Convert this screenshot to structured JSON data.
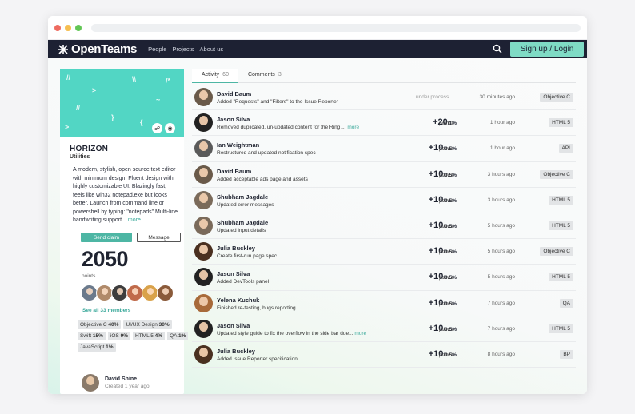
{
  "app": {
    "brand": "OpenTeams",
    "nav_links": [
      "People",
      "Projects",
      "About us"
    ],
    "signup_label": "Sign up / Login",
    "icons": {
      "search": "search-icon",
      "logo": "openteams-logo-icon"
    }
  },
  "project": {
    "title": "HORIZON",
    "category": "Utilities",
    "description": "A modern, stylish, open source text editor with minimum design. Fluent design with highly customizable UI. Blazingly fast, feels like win32 notepad.exe but looks better. Launch from command line or powershell by typing: \"notepads\" Multi-line handwriting support...",
    "more_label": "more",
    "send_claim_label": "Send claim",
    "message_label": "Message",
    "points": "2050",
    "points_label": "points",
    "see_all_label": "See all 33 members",
    "member_colors": [
      "#6b7a8c",
      "#b08a6a",
      "#3e3e3e",
      "#c06a4a",
      "#d9a24a",
      "#8a5a3a"
    ],
    "tags": [
      {
        "name": "Objective C",
        "pct": "40%"
      },
      {
        "name": "UI/UX Design",
        "pct": "30%"
      },
      {
        "name": "Swift",
        "pct": "15%"
      },
      {
        "name": "iOS",
        "pct": "9%"
      },
      {
        "name": "HTML 5",
        "pct": "4%"
      },
      {
        "name": "QA",
        "pct": "1%"
      },
      {
        "name": "JavaScript",
        "pct": "1%"
      }
    ],
    "creator": {
      "name": "David Shine",
      "created": "Created 1 year ago"
    },
    "banner_marks": [
      "//",
      ">",
      "\\\\",
      "~",
      "//",
      "}",
      "{",
      "/*",
      ">"
    ]
  },
  "tabs": [
    {
      "label": "Activity",
      "count": "60",
      "active": true
    },
    {
      "label": "Comments",
      "count": "3",
      "active": false
    }
  ],
  "activity": [
    {
      "name": "David Baum",
      "desc": "Added \"Requests\" and \"Filters\" to the Issue Reporter",
      "more": "",
      "status": "under process",
      "points": "",
      "unit": "",
      "points_label": "",
      "time": "30 minutes ago",
      "tag": "Objective C",
      "avatar": "#6a5a4a"
    },
    {
      "name": "Jason Silva",
      "desc": "Removed duplicated, un-updated content for the Ring ...",
      "more": "more",
      "status": "",
      "points": "+20",
      "unit": "/1%",
      "points_label": "points",
      "time": "1 hour ago",
      "tag": "HTML 5",
      "avatar": "#222222"
    },
    {
      "name": "Ian Weightman",
      "desc": "Restructured and updated notification spec",
      "more": "",
      "status": "",
      "points": "+10",
      "unit": "/0.5%",
      "points_label": "points",
      "time": "1 hour ago",
      "tag": "API",
      "avatar": "#5a5a5a"
    },
    {
      "name": "David Baum",
      "desc": "Added acceptable ads page and assets",
      "more": "",
      "status": "",
      "points": "+10",
      "unit": "/0.5%",
      "points_label": "points",
      "time": "3 hours ago",
      "tag": "Objective C",
      "avatar": "#6a5a4a"
    },
    {
      "name": "Shubham Jagdale",
      "desc": "Updated error messages",
      "more": "",
      "status": "",
      "points": "+10",
      "unit": "/0.5%",
      "points_label": "points",
      "time": "3 hours ago",
      "tag": "HTML 5",
      "avatar": "#7a6a5a"
    },
    {
      "name": "Shubham Jagdale",
      "desc": "Updated input details",
      "more": "",
      "status": "",
      "points": "+10",
      "unit": "/0.5%",
      "points_label": "points",
      "time": "5 hours ago",
      "tag": "HTML 5",
      "avatar": "#7a6a5a"
    },
    {
      "name": "Julia Buckley",
      "desc": "Create first-run page spec",
      "more": "",
      "status": "",
      "points": "+10",
      "unit": "/0.5%",
      "points_label": "points",
      "time": "5 hours ago",
      "tag": "Objective C",
      "avatar": "#4a3020"
    },
    {
      "name": "Jason Silva",
      "desc": "Added DevTools panel",
      "more": "",
      "status": "",
      "points": "+10",
      "unit": "/0.5%",
      "points_label": "points",
      "time": "5 hours ago",
      "tag": "HTML 5",
      "avatar": "#222222"
    },
    {
      "name": "Yelena Kuchuk",
      "desc": "Finished re-testing, bugs reporting",
      "more": "",
      "status": "",
      "points": "+10",
      "unit": "/0.5%",
      "points_label": "points",
      "time": "7 hours ago",
      "tag": "QA",
      "avatar": "#a86a3a"
    },
    {
      "name": "Jason Silva",
      "desc": "Updated style guide to fix the overflow in the side bar due...",
      "more": "more",
      "status": "",
      "points": "+10",
      "unit": "/0.5%",
      "points_label": "points",
      "time": "7 hours ago",
      "tag": "HTML 5",
      "avatar": "#222222"
    },
    {
      "name": "Julia Buckley",
      "desc": "Added Issue Reporter specification",
      "more": "",
      "status": "",
      "points": "+10",
      "unit": "/0.5%",
      "points_label": "points",
      "time": "8 hours ago",
      "tag": "BP",
      "avatar": "#4a3020"
    }
  ]
}
